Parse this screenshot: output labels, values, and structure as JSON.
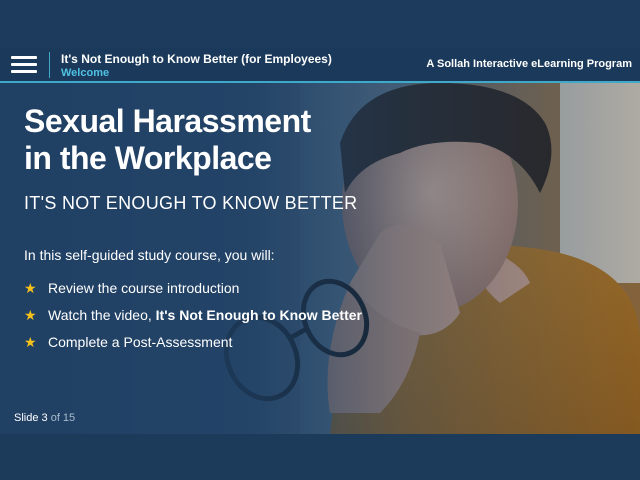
{
  "header": {
    "course_title": "It's Not Enough to Know Better (for Employees)",
    "section_title": "Welcome",
    "brand": "A Sollah Interactive eLearning Program"
  },
  "slide": {
    "title_line1": "Sexual Harassment",
    "title_line2": "in the Workplace",
    "subtitle": "IT'S NOT ENOUGH TO KNOW BETTER",
    "intro": "In this self-guided study course, you will:",
    "bullets": [
      {
        "text": "Review the course introduction"
      },
      {
        "text": "Watch the video, ",
        "bold": "It's Not Enough to Know Better"
      },
      {
        "text": "Complete a Post-Assessment"
      }
    ],
    "counter": {
      "label": "Slide 3",
      "total": "of 15"
    }
  },
  "icons": {
    "menu": "hamburger-menu-icon",
    "bullet": "star-icon"
  },
  "colors": {
    "header_bg": "#1b3a5b",
    "accent": "#3fa9c9",
    "section_title": "#4fc1e3",
    "star": "#f6c21a"
  }
}
